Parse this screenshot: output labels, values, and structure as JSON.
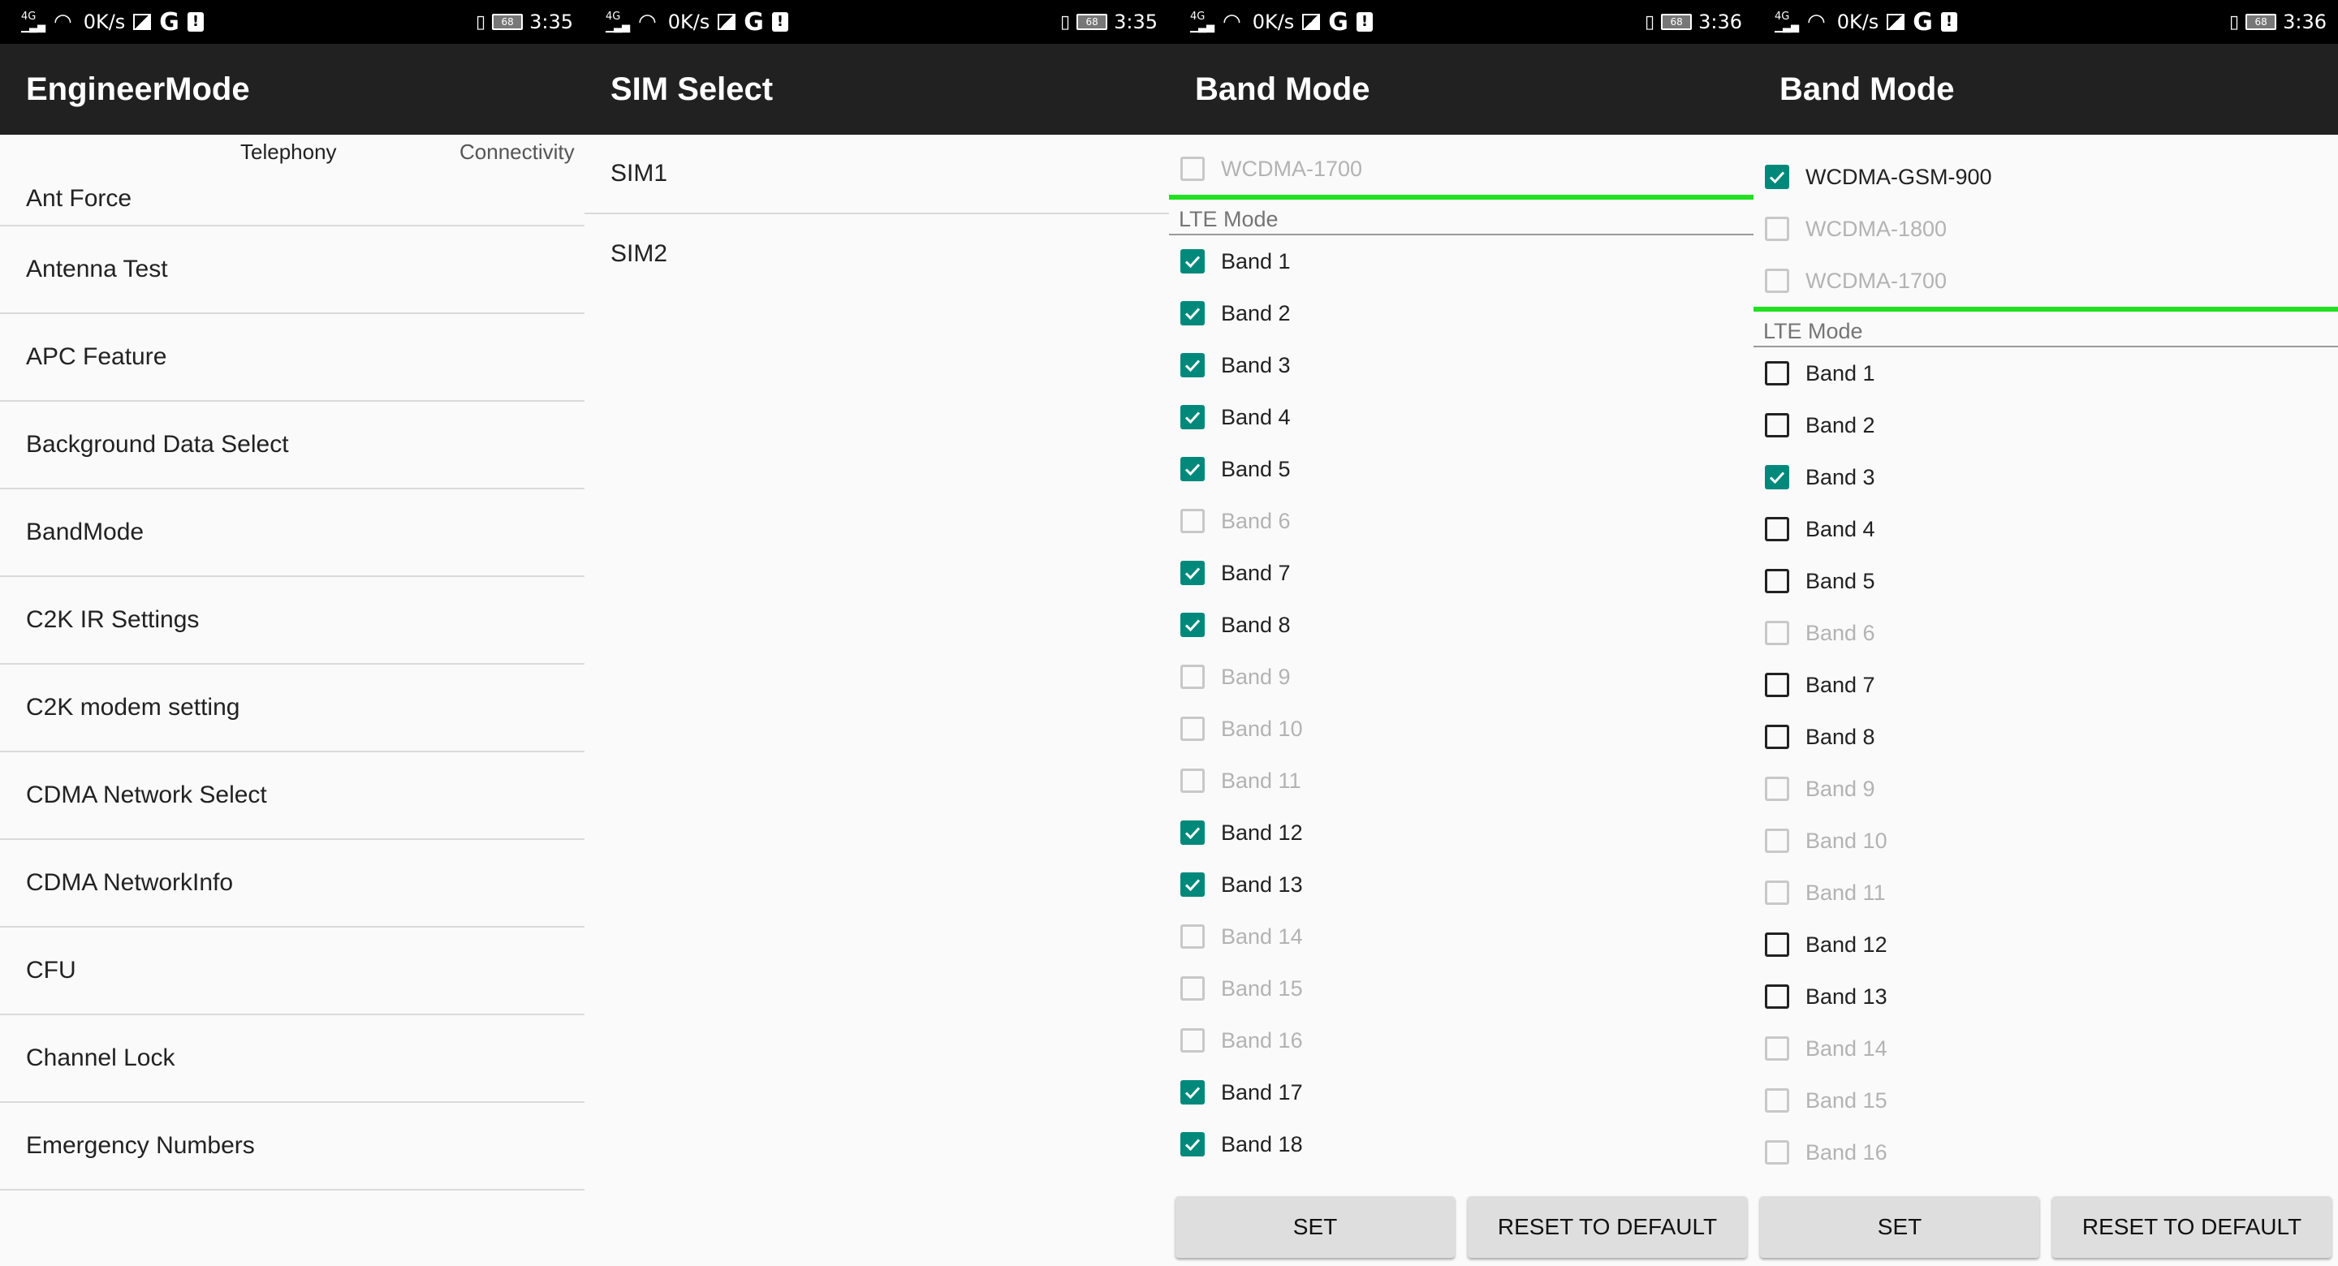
{
  "colors": {
    "toolbar": "#212121",
    "statusbar": "#000000",
    "checked": "#00897b",
    "divider_green": "#20e020"
  },
  "panels": [
    {
      "status": {
        "network": "4G",
        "speed": "0K/s",
        "battery": "68",
        "time": "3:35"
      },
      "title": "EngineerMode",
      "tabs": [
        "Telephony",
        "Connectivity"
      ],
      "items": [
        "Ant Force",
        "Antenna Test",
        "APC Feature",
        "Background Data Select",
        "BandMode",
        "C2K IR Settings",
        "C2K modem setting",
        "CDMA Network Select",
        "CDMA NetworkInfo",
        "CFU",
        "Channel Lock",
        "Emergency Numbers"
      ]
    },
    {
      "status": {
        "network": "4G",
        "speed": "0K/s",
        "battery": "68",
        "time": "3:35"
      },
      "title": "SIM Select",
      "items": [
        "SIM1",
        "SIM2"
      ]
    },
    {
      "status": {
        "network": "4G",
        "speed": "0K/s",
        "battery": "68",
        "time": "3:36"
      },
      "title": "Band Mode",
      "top_items": [
        {
          "label": "WCDMA-1700",
          "state": "disabled"
        }
      ],
      "section": "LTE Mode",
      "bands": [
        {
          "label": "Band 1",
          "state": "checked"
        },
        {
          "label": "Band 2",
          "state": "checked"
        },
        {
          "label": "Band 3",
          "state": "checked"
        },
        {
          "label": "Band 4",
          "state": "checked"
        },
        {
          "label": "Band 5",
          "state": "checked"
        },
        {
          "label": "Band 6",
          "state": "disabled"
        },
        {
          "label": "Band 7",
          "state": "checked"
        },
        {
          "label": "Band 8",
          "state": "checked"
        },
        {
          "label": "Band 9",
          "state": "disabled"
        },
        {
          "label": "Band 10",
          "state": "disabled"
        },
        {
          "label": "Band 11",
          "state": "disabled"
        },
        {
          "label": "Band 12",
          "state": "checked"
        },
        {
          "label": "Band 13",
          "state": "checked"
        },
        {
          "label": "Band 14",
          "state": "disabled"
        },
        {
          "label": "Band 15",
          "state": "disabled"
        },
        {
          "label": "Band 16",
          "state": "disabled"
        },
        {
          "label": "Band 17",
          "state": "checked"
        },
        {
          "label": "Band 18",
          "state": "checked"
        }
      ],
      "buttons": {
        "set": "SET",
        "reset": "RESET TO DEFAULT"
      }
    },
    {
      "status": {
        "network": "4G",
        "speed": "0K/s",
        "battery": "68",
        "time": "3:36"
      },
      "title": "Band Mode",
      "top_items": [
        {
          "label": "WCDMA-GSM-900",
          "state": "checked"
        },
        {
          "label": "WCDMA-1800",
          "state": "disabled"
        },
        {
          "label": "WCDMA-1700",
          "state": "disabled"
        }
      ],
      "section": "LTE Mode",
      "bands": [
        {
          "label": "Band 1",
          "state": "unchecked"
        },
        {
          "label": "Band 2",
          "state": "unchecked"
        },
        {
          "label": "Band 3",
          "state": "checked"
        },
        {
          "label": "Band 4",
          "state": "unchecked"
        },
        {
          "label": "Band 5",
          "state": "unchecked"
        },
        {
          "label": "Band 6",
          "state": "disabled"
        },
        {
          "label": "Band 7",
          "state": "unchecked"
        },
        {
          "label": "Band 8",
          "state": "unchecked"
        },
        {
          "label": "Band 9",
          "state": "disabled"
        },
        {
          "label": "Band 10",
          "state": "disabled"
        },
        {
          "label": "Band 11",
          "state": "disabled"
        },
        {
          "label": "Band 12",
          "state": "unchecked"
        },
        {
          "label": "Band 13",
          "state": "unchecked"
        },
        {
          "label": "Band 14",
          "state": "disabled"
        },
        {
          "label": "Band 15",
          "state": "disabled"
        },
        {
          "label": "Band 16",
          "state": "disabled"
        }
      ],
      "buttons": {
        "set": "SET",
        "reset": "RESET TO DEFAULT"
      }
    }
  ]
}
